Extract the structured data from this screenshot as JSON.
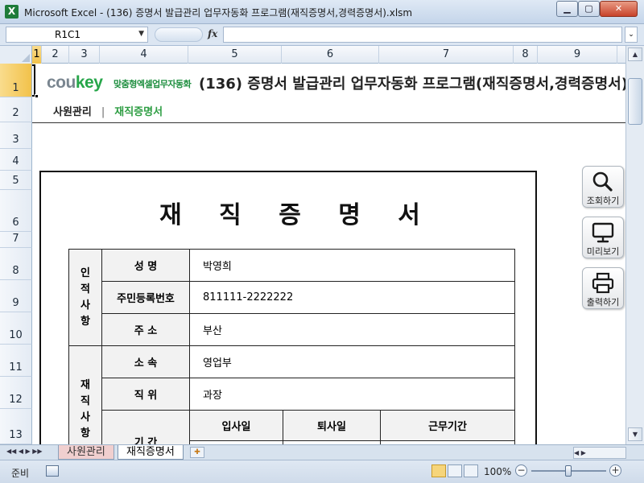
{
  "window": {
    "title": "Microsoft Excel - (136) 증명서 발급관리 업무자동화 프로그램(재직증명서,경력증명서).xlsm",
    "app_icon_glyph": "X",
    "controls": {
      "minimize_glyph": "▁",
      "maximize_glyph": "▢",
      "close_glyph": "✕"
    }
  },
  "formula_bar": {
    "name_box": "R1C1",
    "name_box_arrow": "▼",
    "fx_label": "fx",
    "formula_value": "",
    "expand_glyph": "⌄"
  },
  "columns": [
    "1",
    "2",
    "3",
    "4",
    "5",
    "6",
    "7",
    "8",
    "9"
  ],
  "rows": [
    "1",
    "2",
    "3",
    "4",
    "5",
    "6",
    "7",
    "8",
    "9",
    "10",
    "11",
    "12",
    "13"
  ],
  "sheet": {
    "logo_main": "cou",
    "logo_accent": "key",
    "logo_sub": "맞춤형엑셀업무자동화",
    "doc_title": "(136) 증명서 발급관리 업무자동화 프로그램(재직증명서,경력증명서)",
    "nav": {
      "items": [
        "사원관리",
        "재직증명서"
      ],
      "separator": "|"
    }
  },
  "certificate": {
    "title": "재 직 증 명 서",
    "personal_group": "인\n적\n사\n항",
    "employment_group": "재\n직\n사\n항",
    "labels": {
      "name": "성 명",
      "resident_no": "주민등록번호",
      "address": "주 소",
      "department": "소 속",
      "position": "직 위",
      "period": "기 간"
    },
    "values": {
      "name": "박영희",
      "resident_no": "811111-2222222",
      "address": "부산",
      "department": "영업부",
      "position": "과장"
    },
    "period_columns": [
      "입사일",
      "퇴사일",
      "근무기간"
    ]
  },
  "side_buttons": [
    {
      "label": "조회하기",
      "icon": "search-icon"
    },
    {
      "label": "미리보기",
      "icon": "monitor-icon"
    },
    {
      "label": "출력하기",
      "icon": "printer-icon"
    }
  ],
  "tabs": {
    "nav_glyphs": "◀◀ ◀ ▶ ▶▶",
    "items": [
      "사원관리",
      "재직증명서"
    ],
    "active_index": 1,
    "new_sheet_glyph": "✚",
    "hscroll_glyphs": "◀ ▶"
  },
  "status": {
    "ready": "준비",
    "zoom": "100%",
    "zoom_minus": "−",
    "zoom_plus": "+"
  },
  "colors": {
    "accent_green": "#2f9e44",
    "selection_gold": "#f2c24a",
    "chrome_blue": "#dce6f2"
  }
}
